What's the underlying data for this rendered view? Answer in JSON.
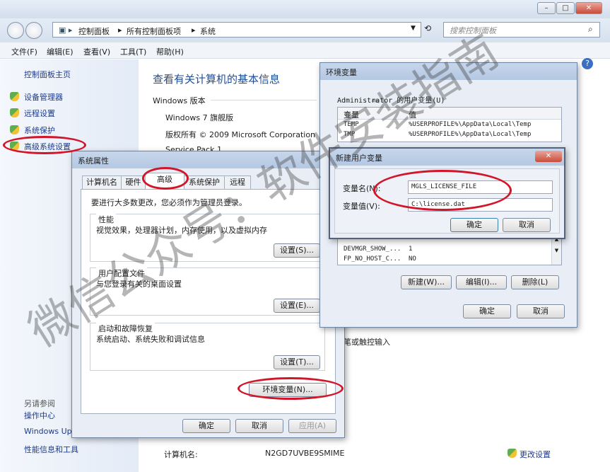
{
  "window": {
    "title_controls": [
      "–",
      "□",
      "✕"
    ],
    "address_path": [
      "控制面板",
      "所有控制面板项",
      "系统"
    ],
    "search_placeholder": "搜索控制面板",
    "menu": [
      "文件(F)",
      "编辑(E)",
      "查看(V)",
      "工具(T)",
      "帮助(H)"
    ]
  },
  "left_pane": {
    "home": "控制面板主页",
    "links": [
      "设备管理器",
      "远程设置",
      "系统保护",
      "高级系统设置"
    ],
    "bottom_links": [
      "操作中心",
      "Windows Up",
      "性能信息和工具"
    ],
    "bottom_partial": "另请参阅"
  },
  "main_info": {
    "heading": "查看有关计算机的基本信息",
    "edition_label": "Windows 版本",
    "edition": "Windows 7 旗舰版",
    "copyright": "版权所有 © 2009 Microsoft Corporation",
    "service_pack": "Service Pack 1",
    "pen_touch": "笔或触控输入",
    "computer_name_label": "计算机名:",
    "computer_name": "N2GD7UVBE9SMIME",
    "change_settings": "更改设置"
  },
  "sys_props": {
    "title": "系统属性",
    "tabs": [
      "计算机名",
      "硬件",
      "高级",
      "系统保护",
      "远程"
    ],
    "admin_note": "要进行大多数更改，您必须作为管理员登录。",
    "perf_title": "性能",
    "perf_desc": "视觉效果，处理器计划，内存使用，以及虚拟内存",
    "profile_title": "用户配置文件",
    "profile_desc": "与您登录有关的桌面设置",
    "startup_title": "启动和故障恢复",
    "startup_desc": "系统启动、系统失败和调试信息",
    "settings_btn": "设置(S)...",
    "settings_btn2": "设置(E)...",
    "settings_btn3": "设置(T)...",
    "env_btn": "环境变量(N)...",
    "ok": "确定",
    "cancel": "取消",
    "apply": "应用(A)"
  },
  "env_dlg": {
    "title": "环境变量",
    "user_vars_label": "Administrator 的用户变量(U)",
    "col_var": "变量",
    "col_val": "值",
    "user_rows": [
      {
        "var": "TEMP",
        "val": "%USERPROFILE%\\AppData\\Local\\Temp"
      },
      {
        "var": "TMP",
        "val": "%USERPROFILE%\\AppData\\Local\\Temp"
      }
    ],
    "sys_rows": [
      {
        "var": "DEVMGR_SHOW_...",
        "val": "1"
      },
      {
        "var": "FP_NO_HOST_C...",
        "val": "NO"
      }
    ],
    "new_btn": "新建(W)...",
    "edit_btn": "编辑(I)...",
    "delete_btn": "删除(L)",
    "ok": "确定",
    "cancel": "取消"
  },
  "new_var_dlg": {
    "title": "新建用户变量",
    "name_label": "变量名(N):",
    "name_value": "MGLS_LICENSE_FILE",
    "value_label": "变量值(V):",
    "value_value": "C:\\license.dat",
    "ok": "确定",
    "cancel": "取消"
  },
  "watermark": "微信公众号：软件安装指南",
  "colors": {
    "highlight_ring": "#d3152a",
    "link": "#1e3a8a",
    "heading": "#1f4e9a"
  }
}
